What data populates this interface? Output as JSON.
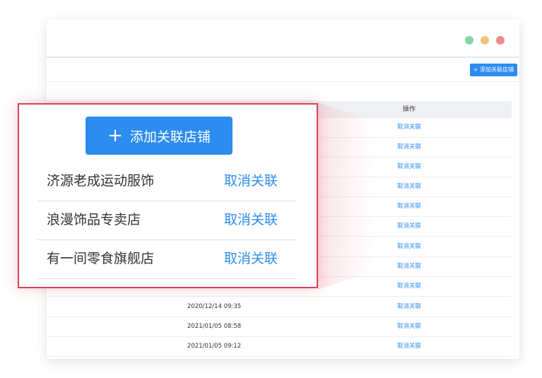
{
  "window_controls": [
    "green-dot",
    "yellow-dot",
    "red-dot"
  ],
  "toolbar": {
    "add_store_label": "+ 添加关联店铺"
  },
  "table": {
    "operation_header": "操作",
    "rows": [
      {
        "date": "",
        "action": "取消关联"
      },
      {
        "date": "",
        "action": "取消关联"
      },
      {
        "date": "",
        "action": "取消关联"
      },
      {
        "date": "",
        "action": "取消关联"
      },
      {
        "date": "",
        "action": "取消关联"
      },
      {
        "date": "",
        "action": "取消关联"
      },
      {
        "date": "",
        "action": "取消关联"
      },
      {
        "date": "",
        "action": "取消关联"
      },
      {
        "date": "",
        "action": "取消关联"
      },
      {
        "date": "2020/12/14 09:35",
        "action": "取消关联"
      },
      {
        "date": "2021/01/05 08:58",
        "action": "取消关联"
      },
      {
        "date": "2021/01/05 09:12",
        "action": "取消关联"
      }
    ]
  },
  "popup": {
    "add_button_plus": "+",
    "add_button_label": "添加关联店铺",
    "stores": [
      {
        "name": "济源老成运动服饰",
        "action": "取消关联"
      },
      {
        "name": "浪漫饰品专卖店",
        "action": "取消关联"
      },
      {
        "name": "有一间零食旗舰店",
        "action": "取消关联"
      }
    ]
  },
  "colors": {
    "accent": "#2d8cf0",
    "highlight_border": "#d9425a"
  }
}
